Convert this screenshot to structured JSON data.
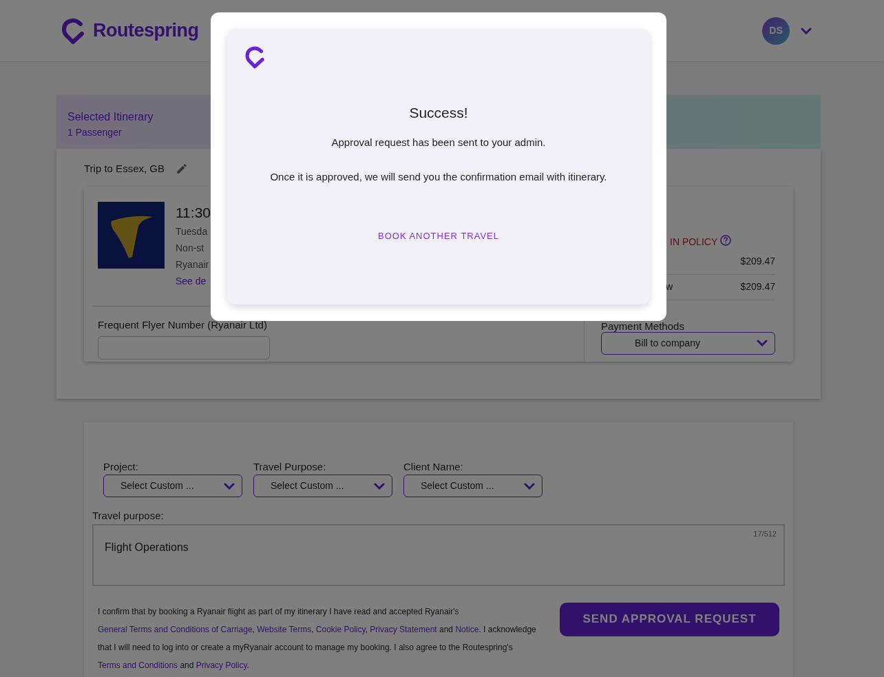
{
  "header": {
    "brand": "Routespring",
    "avatar_initials": "DS"
  },
  "itinerary": {
    "title": "Selected Itinerary",
    "passengers": "1 Passenger",
    "trip_title": "Trip to Essex, GB"
  },
  "flight": {
    "time": "11:30",
    "date": "Tuesda",
    "stops": "Non-st",
    "airline": "Ryanair",
    "details_link": "See de",
    "frequent_flyer_label": "Frequent Flyer Number (Ryanair Ltd)"
  },
  "fare": {
    "policy": "IN POLICY",
    "rows": [
      {
        "amount": "$209.47"
      },
      {
        "label": "w",
        "amount": "$209.47"
      }
    ],
    "payment_label": "Payment Methods",
    "payment_value": "Bill to company"
  },
  "custom_fields": [
    {
      "label": "Project:",
      "value": "Select Custom ..."
    },
    {
      "label": "Travel Purpose:",
      "value": "Select Custom ..."
    },
    {
      "label": "Client Name:",
      "value": "Select Custom ..."
    }
  ],
  "travel_purpose": {
    "label": "Travel purpose:",
    "value": "Flight Operations",
    "counter": "17/512"
  },
  "terms": [
    {
      "kind": "text",
      "text": "I confirm that by booking a Ryanair flight as part of my itinerary I have read and accepted Ryanair's "
    },
    {
      "kind": "link",
      "text": "General Terms and Conditions of Carriage"
    },
    {
      "kind": "text",
      "text": ", "
    },
    {
      "kind": "link",
      "text": "Website Terms"
    },
    {
      "kind": "text",
      "text": ", "
    },
    {
      "kind": "link",
      "text": "Cookie Policy"
    },
    {
      "kind": "text",
      "text": ", "
    },
    {
      "kind": "link",
      "text": "Privacy Statement"
    },
    {
      "kind": "text",
      "text": " and "
    },
    {
      "kind": "link",
      "text": "Notice"
    },
    {
      "kind": "text",
      "text": ". I acknowledge that I will need to log into or create a myRyanair account to manage my booking. I also agree to the Routespring's "
    },
    {
      "kind": "link",
      "text": "Terms and Conditions"
    },
    {
      "kind": "text",
      "text": " and "
    },
    {
      "kind": "link",
      "text": "Privacy Policy"
    },
    {
      "kind": "text",
      "text": "."
    }
  ],
  "submit_button": "SEND APPROVAL REQUEST",
  "modal": {
    "title": "Success!",
    "message": "Approval request has been sent to your admin.",
    "note": "Once it is approved, we will send you the confirmation email with itinerary.",
    "link": "BOOK ANOTHER TRAVEL"
  }
}
